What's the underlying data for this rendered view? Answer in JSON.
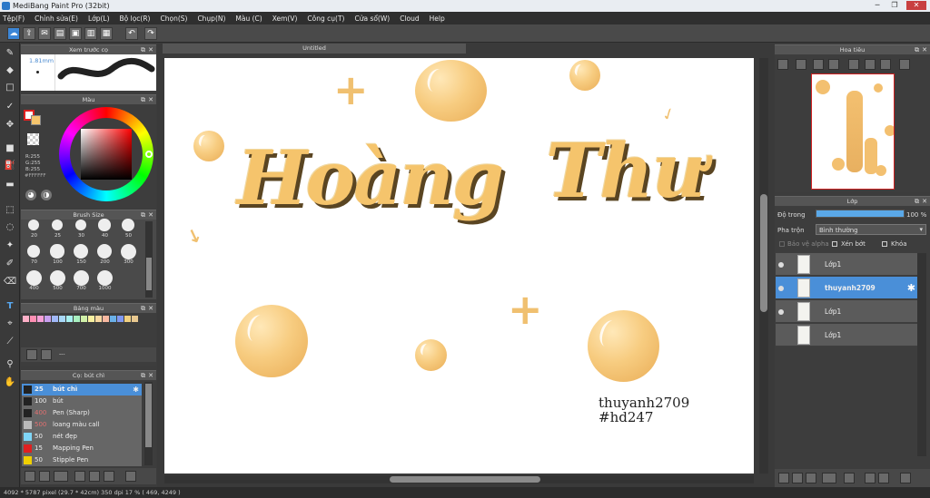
{
  "titlebar": {
    "title": "MediBang Paint Pro (32bit)"
  },
  "menu": [
    "Tệp(F)",
    "Chỉnh sửa(E)",
    "Lớp(L)",
    "Bộ lọc(R)",
    "Chọn(S)",
    "Chụp(N)",
    "Màu (C)",
    "Xem(V)",
    "Công cụ(T)",
    "Cửa sổ(W)",
    "Cloud",
    "Help"
  ],
  "brush_preview": {
    "title": "Xem trước cọ",
    "size": "1.81mm"
  },
  "color_panel": {
    "title": "Màu",
    "r": "R:255",
    "g": "G:255",
    "b": "B:255",
    "hex": "#FFFFFF"
  },
  "brush_size": {
    "title": "Brush Size",
    "sizes": [
      "20",
      "25",
      "30",
      "40",
      "50",
      "70",
      "100",
      "150",
      "200",
      "300",
      "400",
      "500",
      "700",
      "1000"
    ]
  },
  "palette": {
    "title": "Bảng màu",
    "colors": [
      "#ffb0c8",
      "#ff8fb3",
      "#f6a0d8",
      "#c8a0f0",
      "#a0b8f8",
      "#a8d8f8",
      "#a8f0f0",
      "#a8f0c0",
      "#d0f0a8",
      "#f8f0a0",
      "#f8d8a0",
      "#f8b8a0",
      "#6ab0e8",
      "#8098f0",
      "#f0d080",
      "#e8c890"
    ],
    "note": "---"
  },
  "brush_list": {
    "title": "Cọ: bút chì",
    "items": [
      {
        "size": "25",
        "name": "bút chì",
        "color": "#222",
        "selected": true
      },
      {
        "size": "100",
        "name": "bút",
        "color": "#222"
      },
      {
        "size": "400",
        "name": "Pen (Sharp)",
        "color": "#222"
      },
      {
        "size": "500",
        "name": "loang màu call",
        "color": "#bbb"
      },
      {
        "size": "50",
        "name": "nét đẹp",
        "color": "#7fd6f8"
      },
      {
        "size": "15",
        "name": "Mapping Pen",
        "color": "#e02020"
      },
      {
        "size": "50",
        "name": "Stipple Pen",
        "color": "#f0d000"
      }
    ]
  },
  "canvas": {
    "tab": "Untitled",
    "title_left": "Hoàng",
    "title_right": "Thư",
    "sign1": "thuyanh2709",
    "sign2": "#hd247",
    "accent": "#f5c46c"
  },
  "navigator": {
    "title": "Hoa tiêu"
  },
  "layers": {
    "title": "Lớp",
    "opacity_label": "Độ trong",
    "opacity_value": "100 %",
    "opacity_fraction": 1.0,
    "blend_label": "Pha trộn",
    "blend_value": "Bình thường",
    "protect_alpha": "Bảo vệ alpha",
    "clipping": "Xén bớt",
    "lock": "Khóa",
    "rows": [
      {
        "name": "Lớp1",
        "selected": false,
        "visible": true
      },
      {
        "name": "thuyanh2709",
        "selected": true,
        "visible": true
      },
      {
        "name": "Lớp1",
        "selected": false,
        "visible": true
      },
      {
        "name": "Lớp1",
        "selected": false,
        "visible": false
      }
    ]
  },
  "statusbar": {
    "text": "4092 * 5787 pixel   (29.7 * 42cm)   350 dpi   17 %   ( 469, 4249 )"
  }
}
